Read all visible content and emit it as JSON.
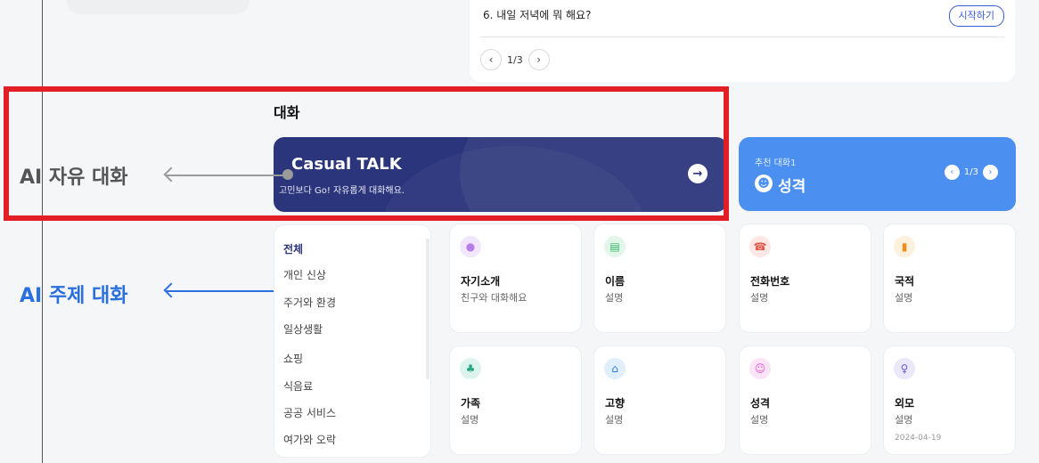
{
  "question": {
    "text": "6. 내일 저녁에 뭐 해요?",
    "start_label": "시작하기",
    "pager": {
      "prev": "‹",
      "label": "1/3",
      "next": "›"
    }
  },
  "section": {
    "title": "대화"
  },
  "casual": {
    "title": "Casual TALK",
    "subtitle": "고민보다 Go! 자유롭게 대화해요.",
    "arrow": "→"
  },
  "recommend": {
    "label": "추천 대화1",
    "title": "성격",
    "icon": "☻",
    "pager": {
      "prev": "‹",
      "label": "1/3",
      "next": "›"
    }
  },
  "annotations": {
    "free": "AI 자유 대화",
    "topic": "AI 주제 대화"
  },
  "categories": [
    {
      "label": "전체",
      "active": true
    },
    {
      "label": "개인 신상"
    },
    {
      "label": "주거와 환경"
    },
    {
      "label": "일상생활"
    },
    {
      "label": "쇼핑"
    },
    {
      "label": "식음료"
    },
    {
      "label": "공공 서비스"
    },
    {
      "label": "여가와 오락"
    }
  ],
  "topics": [
    {
      "title": "자기소개",
      "desc": "친구와 대화해요",
      "icon": "person-icon",
      "glyph": "●",
      "bg": "#f1e6fb",
      "fg": "#b87ee8"
    },
    {
      "title": "이름",
      "desc": "설명",
      "icon": "id-card-icon",
      "glyph": "▤",
      "bg": "#e2f6ea",
      "fg": "#33b868"
    },
    {
      "title": "전화번호",
      "desc": "설명",
      "icon": "phone-icon",
      "glyph": "☎",
      "bg": "#fde6e4",
      "fg": "#e4584a"
    },
    {
      "title": "국적",
      "desc": "설명",
      "icon": "passport-icon",
      "glyph": "▮",
      "bg": "#fdf0dc",
      "fg": "#f08d1a"
    },
    {
      "title": "가족",
      "desc": "설명",
      "icon": "family-icon",
      "glyph": "♣",
      "bg": "#ddf4ee",
      "fg": "#23a884"
    },
    {
      "title": "고향",
      "desc": "설명",
      "icon": "home-icon",
      "glyph": "⌂",
      "bg": "#e1eefc",
      "fg": "#2a7ee0"
    },
    {
      "title": "성격",
      "desc": "설명",
      "icon": "smile-icon",
      "glyph": "☺",
      "bg": "#fbe4f6",
      "fg": "#e25bd0"
    },
    {
      "title": "외모",
      "desc": "설명",
      "date": "2024-04-19",
      "icon": "figure-icon",
      "glyph": "♀",
      "bg": "#ebe8fb",
      "fg": "#6b5ad8"
    }
  ]
}
